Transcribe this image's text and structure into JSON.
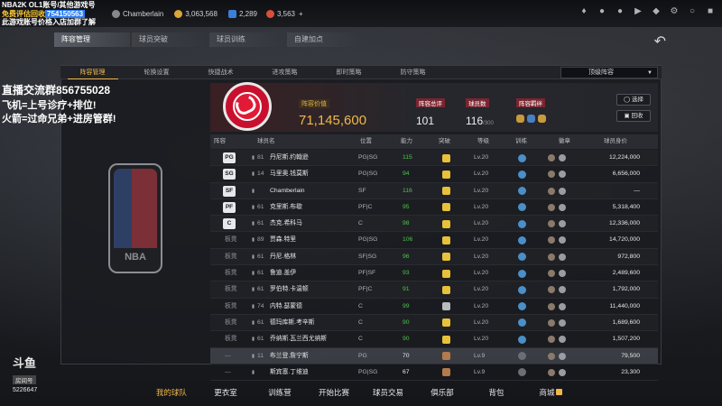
{
  "overlay": {
    "line1": "NBA2K OL1账号/其他游戏号",
    "line2_prefix": "免费评估回收",
    "line2_number": "754150563",
    "line3": "此游戏账号价格入店加群了解",
    "group_line": "直播交流群856755028",
    "promo1": "飞机=上号诊疗+排位!",
    "promo2": "火箭=过命兄弟+进房管群!",
    "douyu_logo": "斗鱼",
    "room_label": "房间号",
    "room_id": "5226647"
  },
  "topbar": {
    "player_name": "Chamberlain",
    "coins": "3,063,568",
    "gems": "2,289",
    "tokens": "3,563",
    "plus": "+"
  },
  "main_tabs": [
    "阵容管理",
    "球员突破",
    "球员训练",
    "自建加点"
  ],
  "sub_tabs": [
    "阵容管理",
    "轮换设置",
    "快捷战术",
    "进攻策略",
    "即时策略",
    "防守策略"
  ],
  "lineup_dropdown": "顶级阵容",
  "team": {
    "value_label": "阵容价值",
    "value": "71,145,600",
    "total_rating_label": "阵容总评",
    "total_rating": "101",
    "player_count_label": "球员数",
    "player_count": "116",
    "player_count_max": "/300",
    "chemistry_label": "阵容羁绊",
    "select_button": "选择",
    "recall_button": "回收"
  },
  "table_headers": [
    "阵容",
    "球员名",
    "位置",
    "能力",
    "突破",
    "等级",
    "训练",
    "徽章",
    "球员身价"
  ],
  "players": [
    {
      "slot": "PG",
      "number": "81",
      "name": "丹尼斯.约翰逊",
      "position": "PG|SG",
      "rating": "115",
      "level": "Lv.20",
      "value": "12,224,000",
      "slot_type": "starter",
      "rating_color": "green",
      "break_icon": "gold"
    },
    {
      "slot": "SG",
      "number": "14",
      "name": "马里奥.钱莫斯",
      "position": "PG|SG",
      "rating": "94",
      "level": "Lv.20",
      "value": "6,656,000",
      "slot_type": "starter",
      "rating_color": "green",
      "break_icon": "gold"
    },
    {
      "slot": "SF",
      "number": "",
      "name": "Chamberlain",
      "position": "SF",
      "rating": "116",
      "level": "Lv.20",
      "value": "—",
      "slot_type": "starter",
      "rating_color": "green",
      "break_icon": "gold"
    },
    {
      "slot": "PF",
      "number": "61",
      "name": "克里斯.布歇",
      "position": "PF|C",
      "rating": "95",
      "level": "Lv.20",
      "value": "5,318,400",
      "slot_type": "starter",
      "rating_color": "green",
      "break_icon": "gold"
    },
    {
      "slot": "C",
      "number": "61",
      "name": "杰克.希科马",
      "position": "C",
      "rating": "98",
      "level": "Lv.20",
      "value": "12,336,000",
      "slot_type": "starter",
      "rating_color": "green",
      "break_icon": "gold"
    },
    {
      "slot": "板凳",
      "number": "89",
      "name": "贾森.特里",
      "position": "PG|SG",
      "rating": "106",
      "level": "Lv.20",
      "value": "14,720,000",
      "slot_type": "bench",
      "rating_color": "green",
      "break_icon": "gold"
    },
    {
      "slot": "板凳",
      "number": "61",
      "name": "丹尼.格林",
      "position": "SF|SG",
      "rating": "96",
      "level": "Lv.20",
      "value": "972,800",
      "slot_type": "bench",
      "rating_color": "green",
      "break_icon": "gold"
    },
    {
      "slot": "板凳",
      "number": "61",
      "name": "鲁迪.盖伊",
      "position": "PF|SF",
      "rating": "93",
      "level": "Lv.20",
      "value": "2,489,600",
      "slot_type": "bench",
      "rating_color": "green",
      "break_icon": "gold"
    },
    {
      "slot": "板凳",
      "number": "61",
      "name": "罗伯特.卡温顿",
      "position": "PF|C",
      "rating": "91",
      "level": "Lv.20",
      "value": "1,792,000",
      "slot_type": "bench",
      "rating_color": "green",
      "break_icon": "gold"
    },
    {
      "slot": "板凳",
      "number": "74",
      "name": "内特.瑟蒙德",
      "position": "C",
      "rating": "99",
      "level": "Lv.20",
      "value": "11,440,000",
      "slot_type": "bench",
      "rating_color": "green",
      "break_icon": "grey"
    },
    {
      "slot": "板凳",
      "number": "61",
      "name": "德玛库斯.考辛斯",
      "position": "C",
      "rating": "90",
      "level": "Lv.20",
      "value": "1,689,600",
      "slot_type": "bench",
      "rating_color": "green",
      "break_icon": "gold"
    },
    {
      "slot": "板凳",
      "number": "61",
      "name": "乔纳斯.瓦兰西尤纳斯",
      "position": "C",
      "rating": "90",
      "level": "Lv.20",
      "value": "1,507,200",
      "slot_type": "bench",
      "rating_color": "green",
      "break_icon": "gold"
    },
    {
      "slot": "—",
      "number": "11",
      "name": "布兰登.詹宁斯",
      "position": "PG",
      "rating": "70",
      "level": "Lv.9",
      "value": "79,500",
      "slot_type": "reserve",
      "rating_color": "white",
      "break_icon": "bronze"
    },
    {
      "slot": "—",
      "number": "",
      "name": "斯宾塞.丁维迪",
      "position": "PG|SG",
      "rating": "67",
      "level": "Lv.9",
      "value": "23,300",
      "slot_type": "reserve",
      "rating_color": "white",
      "break_icon": "bronze"
    }
  ],
  "nba_logo_text": "NBA",
  "bottom_nav": [
    "我的球队",
    "更衣室",
    "训练营",
    "开始比赛",
    "球员交易",
    "俱乐部",
    "背包",
    "商城"
  ],
  "colors": {
    "accent": "#f0b84a",
    "rating_green": "#4dc24d",
    "hawks_red": "#c8102e"
  }
}
